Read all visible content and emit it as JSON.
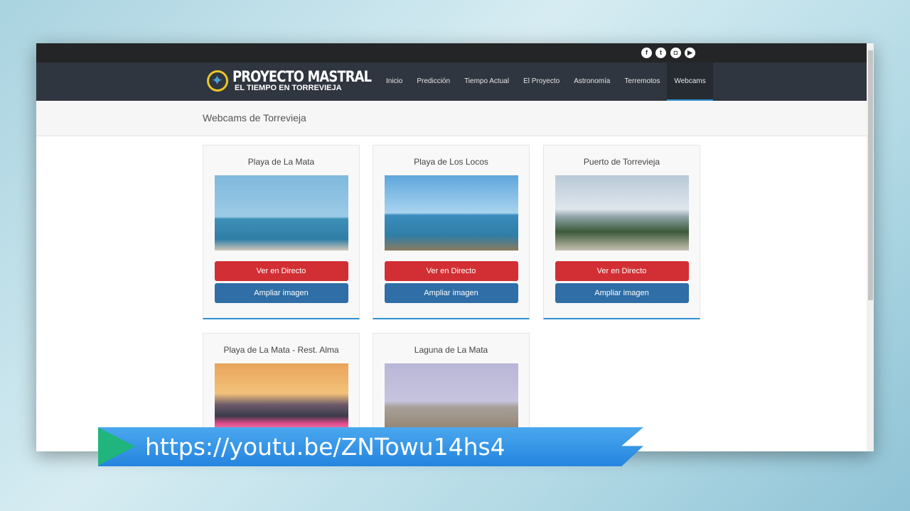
{
  "social": [
    "facebook-icon",
    "twitter-icon",
    "instagram-icon",
    "youtube-icon"
  ],
  "logo": {
    "title": "PROYECTO MASTRAL",
    "subtitle": "EL TIEMPO EN TORREVIEJA"
  },
  "nav": [
    "Inicio",
    "Predicción",
    "Tiempo Actual",
    "El Proyecto",
    "Astronomía",
    "Terremotos",
    "Webcams"
  ],
  "active_nav": "Webcams",
  "page_title": "Webcams de Torrevieja",
  "cards": [
    {
      "title": "Playa de La Mata",
      "live": "Ver en Directo",
      "zoom": "Ampliar imagen"
    },
    {
      "title": "Playa de Los Locos",
      "live": "Ver en Directo",
      "zoom": "Ampliar imagen"
    },
    {
      "title": "Puerto de Torrevieja",
      "live": "Ver en Directo",
      "zoom": "Ampliar imagen"
    },
    {
      "title": "Playa de La Mata - Rest. Alma"
    },
    {
      "title": "Laguna de La Mata"
    }
  ],
  "banner": {
    "link": "https://youtu.be/ZNTowu14hs4"
  },
  "colors": {
    "red": "#d22f34",
    "blue": "#2f6ea6",
    "nav": "#30363f",
    "banner": "#2f8fe6"
  }
}
